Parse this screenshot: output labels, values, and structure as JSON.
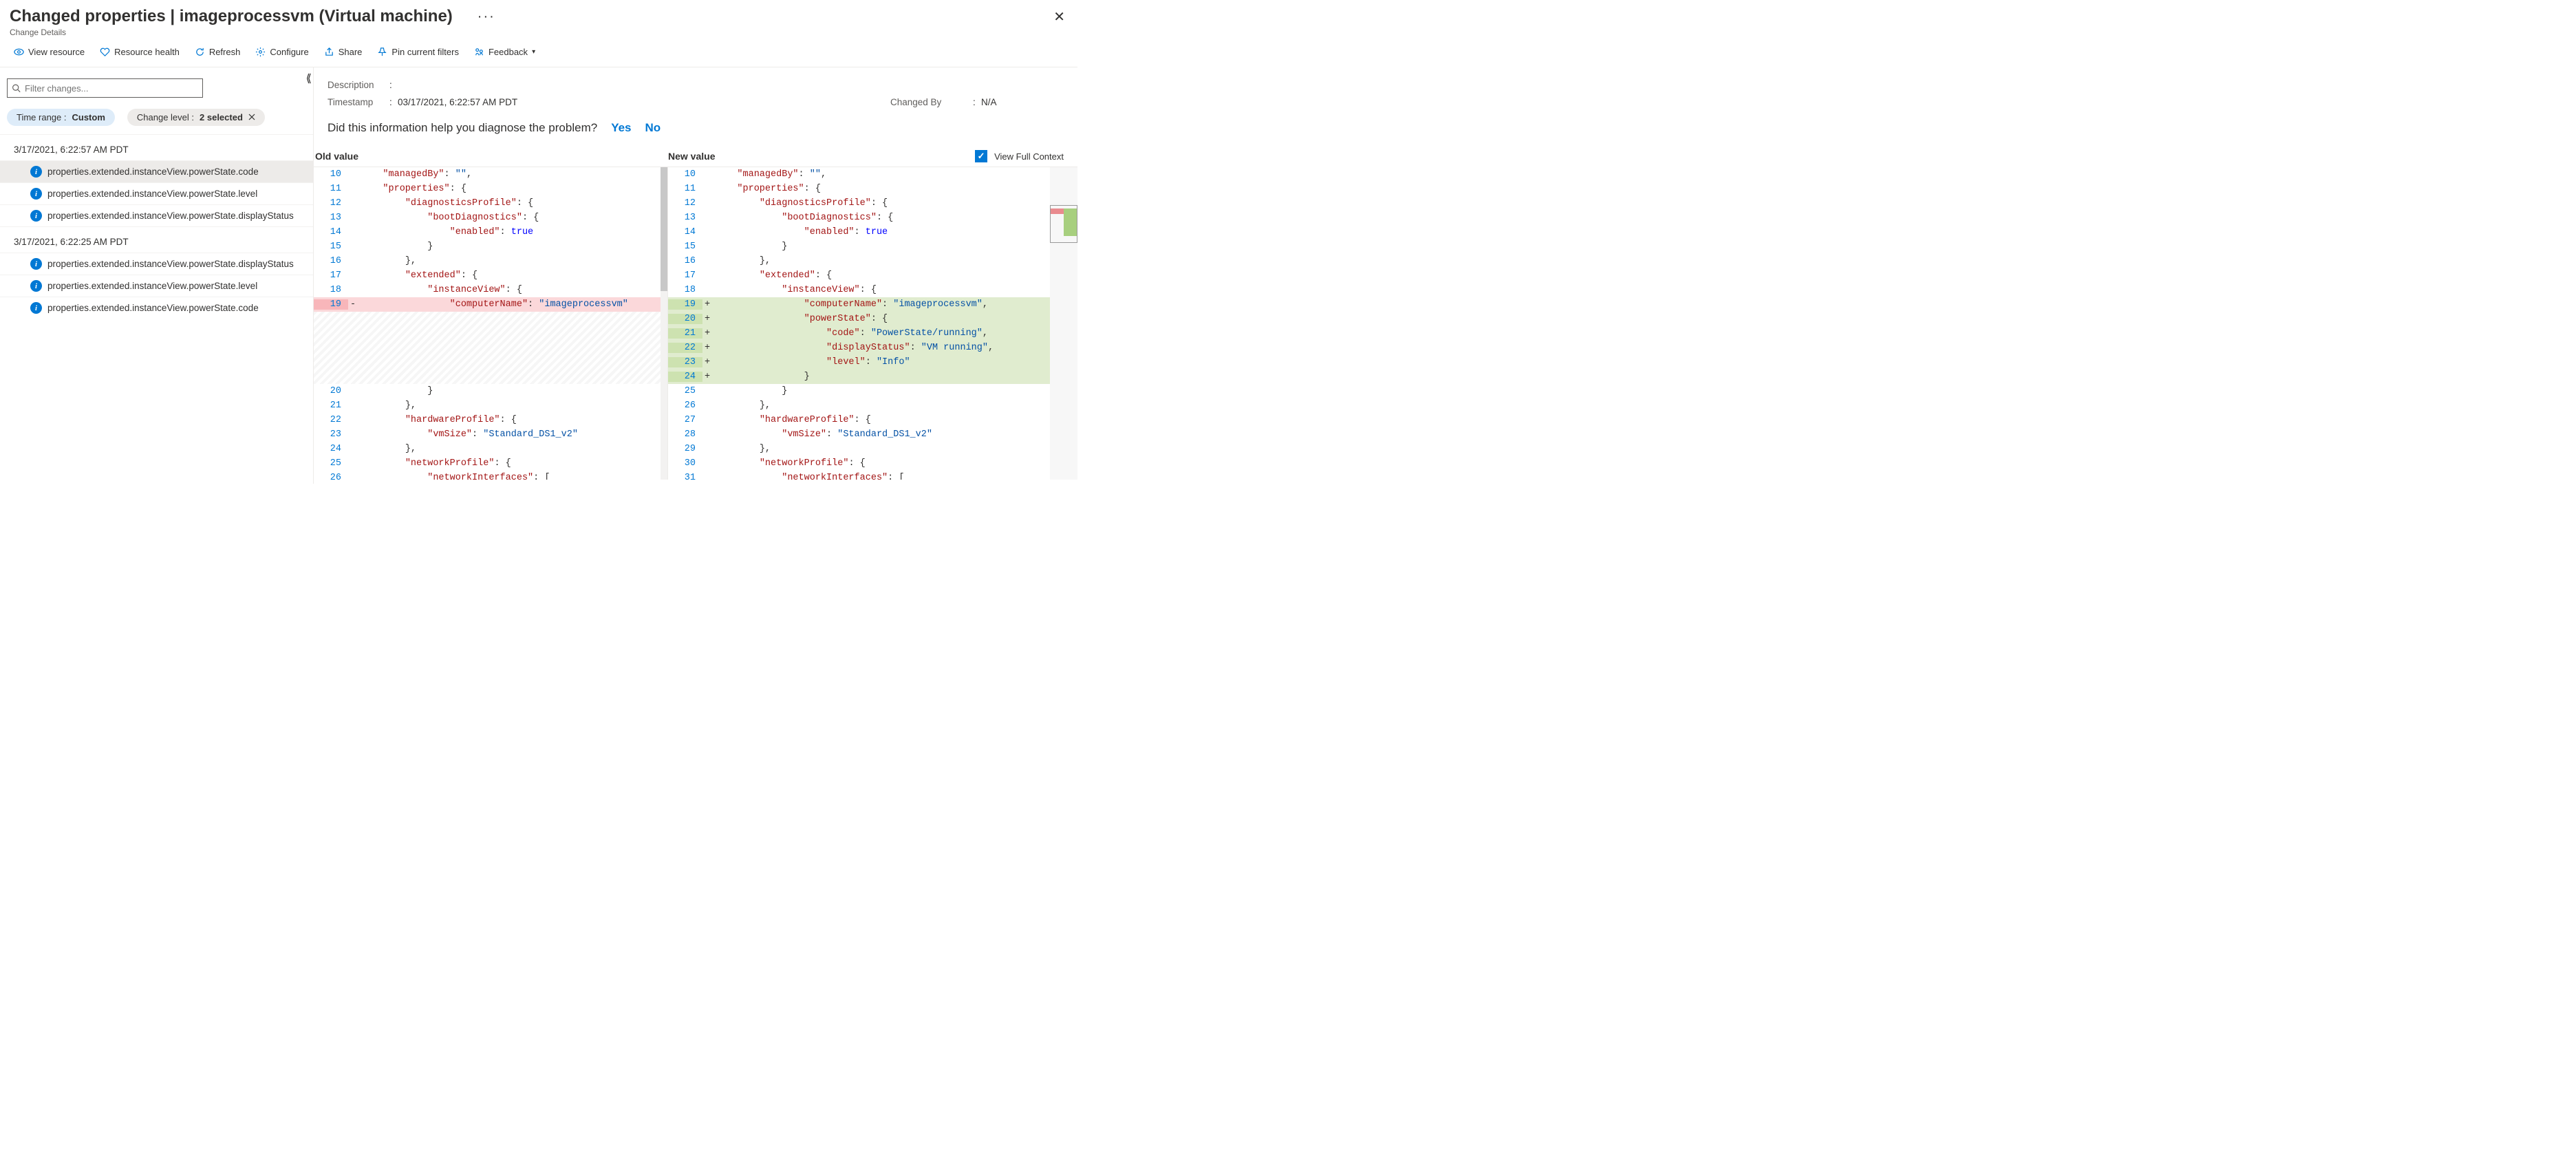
{
  "header": {
    "title": "Changed properties | imageprocessvm (Virtual machine)",
    "crumb": "Change Details"
  },
  "toolbar": [
    {
      "k": "view-resource",
      "label": "View resource"
    },
    {
      "k": "resource-health",
      "label": "Resource health"
    },
    {
      "k": "refresh",
      "label": "Refresh"
    },
    {
      "k": "configure",
      "label": "Configure"
    },
    {
      "k": "share",
      "label": "Share"
    },
    {
      "k": "pin",
      "label": "Pin current filters"
    },
    {
      "k": "feedback",
      "label": "Feedback"
    }
  ],
  "filter": {
    "placeholder": "Filter changes...",
    "pills": {
      "timerange_label": "Time range : ",
      "timerange_value": "Custom",
      "level_label": "Change level : ",
      "level_value": "2 selected"
    }
  },
  "groups": [
    {
      "ts": "3/17/2021, 6:22:57 AM PDT",
      "rows": [
        "properties.extended.instanceView.powerState.code",
        "properties.extended.instanceView.powerState.level",
        "properties.extended.instanceView.powerState.displayStatus"
      ],
      "selected_idx": 0
    },
    {
      "ts": "3/17/2021, 6:22:25 AM PDT",
      "rows": [
        "properties.extended.instanceView.powerState.displayStatus",
        "properties.extended.instanceView.powerState.level",
        "properties.extended.instanceView.powerState.code"
      ],
      "selected_idx": -1
    }
  ],
  "meta": {
    "desc_label": "Description",
    "desc_value": "",
    "ts_label": "Timestamp",
    "ts_value": "03/17/2021, 6:22:57 AM PDT",
    "by_label": "Changed By",
    "by_value": "N/A"
  },
  "ask": {
    "q": "Did this information help you diagnose the problem?",
    "yes": "Yes",
    "no": "No"
  },
  "diff_header": {
    "old": "Old value",
    "new": "New value",
    "ctx": "View Full Context"
  },
  "diff_old": [
    {
      "n": 10,
      "segs": [
        [
          "\"managedBy\"",
          "red"
        ],
        [
          ": ",
          ""
        ],
        [
          "\"\"",
          "blue"
        ],
        [
          ",",
          ""
        ]
      ],
      "indent": 2
    },
    {
      "n": 11,
      "segs": [
        [
          "\"properties\"",
          "red"
        ],
        [
          ": {",
          ""
        ]
      ],
      "indent": 2
    },
    {
      "n": 12,
      "segs": [
        [
          "\"diagnosticsProfile\"",
          "red"
        ],
        [
          ": {",
          ""
        ]
      ],
      "indent": 4
    },
    {
      "n": 13,
      "segs": [
        [
          "\"bootDiagnostics\"",
          "red"
        ],
        [
          ": {",
          ""
        ]
      ],
      "indent": 6
    },
    {
      "n": 14,
      "segs": [
        [
          "\"enabled\"",
          "red"
        ],
        [
          ": ",
          ""
        ],
        [
          "true",
          "dkblue"
        ]
      ],
      "indent": 8
    },
    {
      "n": 15,
      "segs": [
        [
          "}",
          ""
        ]
      ],
      "indent": 6
    },
    {
      "n": 16,
      "segs": [
        [
          "},",
          ""
        ]
      ],
      "indent": 4
    },
    {
      "n": 17,
      "segs": [
        [
          "\"extended\"",
          "red"
        ],
        [
          ": {",
          ""
        ]
      ],
      "indent": 4
    },
    {
      "n": 18,
      "segs": [
        [
          "\"instanceView\"",
          "red"
        ],
        [
          ": {",
          ""
        ]
      ],
      "indent": 6
    },
    {
      "n": 19,
      "mark": "-",
      "cls": "removed",
      "segs": [
        [
          "\"computerName\"",
          "red"
        ],
        [
          ": ",
          ""
        ],
        [
          "\"imageprocessvm\"",
          "blue"
        ]
      ],
      "indent": 8
    },
    {
      "filler": true
    },
    {
      "n": 20,
      "segs": [
        [
          "}",
          ""
        ]
      ],
      "indent": 6
    },
    {
      "n": 21,
      "segs": [
        [
          "},",
          ""
        ]
      ],
      "indent": 4
    },
    {
      "n": 22,
      "segs": [
        [
          "\"hardwareProfile\"",
          "red"
        ],
        [
          ": {",
          ""
        ]
      ],
      "indent": 4
    },
    {
      "n": 23,
      "segs": [
        [
          "\"vmSize\"",
          "red"
        ],
        [
          ": ",
          ""
        ],
        [
          "\"Standard_DS1_v2\"",
          "blue"
        ]
      ],
      "indent": 6
    },
    {
      "n": 24,
      "segs": [
        [
          "},",
          ""
        ]
      ],
      "indent": 4
    },
    {
      "n": 25,
      "segs": [
        [
          "\"networkProfile\"",
          "red"
        ],
        [
          ": {",
          ""
        ]
      ],
      "indent": 4
    },
    {
      "n": 26,
      "segs": [
        [
          "\"networkInterfaces\"",
          "red"
        ],
        [
          ": [",
          ""
        ]
      ],
      "indent": 6
    }
  ],
  "diff_new": [
    {
      "n": 10,
      "segs": [
        [
          "\"managedBy\"",
          "red"
        ],
        [
          ": ",
          ""
        ],
        [
          "\"\"",
          "blue"
        ],
        [
          ",",
          ""
        ]
      ],
      "indent": 2
    },
    {
      "n": 11,
      "segs": [
        [
          "\"properties\"",
          "red"
        ],
        [
          ": {",
          ""
        ]
      ],
      "indent": 2
    },
    {
      "n": 12,
      "segs": [
        [
          "\"diagnosticsProfile\"",
          "red"
        ],
        [
          ": {",
          ""
        ]
      ],
      "indent": 4
    },
    {
      "n": 13,
      "segs": [
        [
          "\"bootDiagnostics\"",
          "red"
        ],
        [
          ": {",
          ""
        ]
      ],
      "indent": 6
    },
    {
      "n": 14,
      "segs": [
        [
          "\"enabled\"",
          "red"
        ],
        [
          ": ",
          ""
        ],
        [
          "true",
          "dkblue"
        ]
      ],
      "indent": 8
    },
    {
      "n": 15,
      "segs": [
        [
          "}",
          ""
        ]
      ],
      "indent": 6
    },
    {
      "n": 16,
      "segs": [
        [
          "},",
          ""
        ]
      ],
      "indent": 4
    },
    {
      "n": 17,
      "segs": [
        [
          "\"extended\"",
          "red"
        ],
        [
          ": {",
          ""
        ]
      ],
      "indent": 4
    },
    {
      "n": 18,
      "segs": [
        [
          "\"instanceView\"",
          "red"
        ],
        [
          ": {",
          ""
        ]
      ],
      "indent": 6
    },
    {
      "n": 19,
      "mark": "+",
      "cls": "added",
      "segs": [
        [
          "\"computerName\"",
          "red"
        ],
        [
          ": ",
          ""
        ],
        [
          "\"imageprocessvm\"",
          "blue"
        ],
        [
          ",",
          ""
        ]
      ],
      "indent": 8
    },
    {
      "n": 20,
      "mark": "+",
      "cls": "added",
      "segs": [
        [
          "\"powerState\"",
          "red"
        ],
        [
          ": {",
          ""
        ]
      ],
      "indent": 8
    },
    {
      "n": 21,
      "mark": "+",
      "cls": "added",
      "segs": [
        [
          "\"code\"",
          "red"
        ],
        [
          ": ",
          ""
        ],
        [
          "\"PowerState/running\"",
          "blue"
        ],
        [
          ",",
          ""
        ]
      ],
      "indent": 10
    },
    {
      "n": 22,
      "mark": "+",
      "cls": "added",
      "segs": [
        [
          "\"displayStatus\"",
          "red"
        ],
        [
          ": ",
          ""
        ],
        [
          "\"VM running\"",
          "blue"
        ],
        [
          ",",
          ""
        ]
      ],
      "indent": 10
    },
    {
      "n": 23,
      "mark": "+",
      "cls": "added",
      "segs": [
        [
          "\"level\"",
          "red"
        ],
        [
          ": ",
          ""
        ],
        [
          "\"Info\"",
          "blue"
        ]
      ],
      "indent": 10
    },
    {
      "n": 24,
      "mark": "+",
      "cls": "added",
      "segs": [
        [
          "}",
          ""
        ]
      ],
      "indent": 8
    },
    {
      "n": 25,
      "segs": [
        [
          "}",
          ""
        ]
      ],
      "indent": 6
    },
    {
      "n": 26,
      "segs": [
        [
          "},",
          ""
        ]
      ],
      "indent": 4
    },
    {
      "n": 27,
      "segs": [
        [
          "\"hardwareProfile\"",
          "red"
        ],
        [
          ": {",
          ""
        ]
      ],
      "indent": 4
    },
    {
      "n": 28,
      "segs": [
        [
          "\"vmSize\"",
          "red"
        ],
        [
          ": ",
          ""
        ],
        [
          "\"Standard_DS1_v2\"",
          "blue"
        ]
      ],
      "indent": 6
    },
    {
      "n": 29,
      "segs": [
        [
          "},",
          ""
        ]
      ],
      "indent": 4
    },
    {
      "n": 30,
      "segs": [
        [
          "\"networkProfile\"",
          "red"
        ],
        [
          ": {",
          ""
        ]
      ],
      "indent": 4
    },
    {
      "n": 31,
      "segs": [
        [
          "\"networkInterfaces\"",
          "red"
        ],
        [
          ": [",
          ""
        ]
      ],
      "indent": 6
    }
  ]
}
